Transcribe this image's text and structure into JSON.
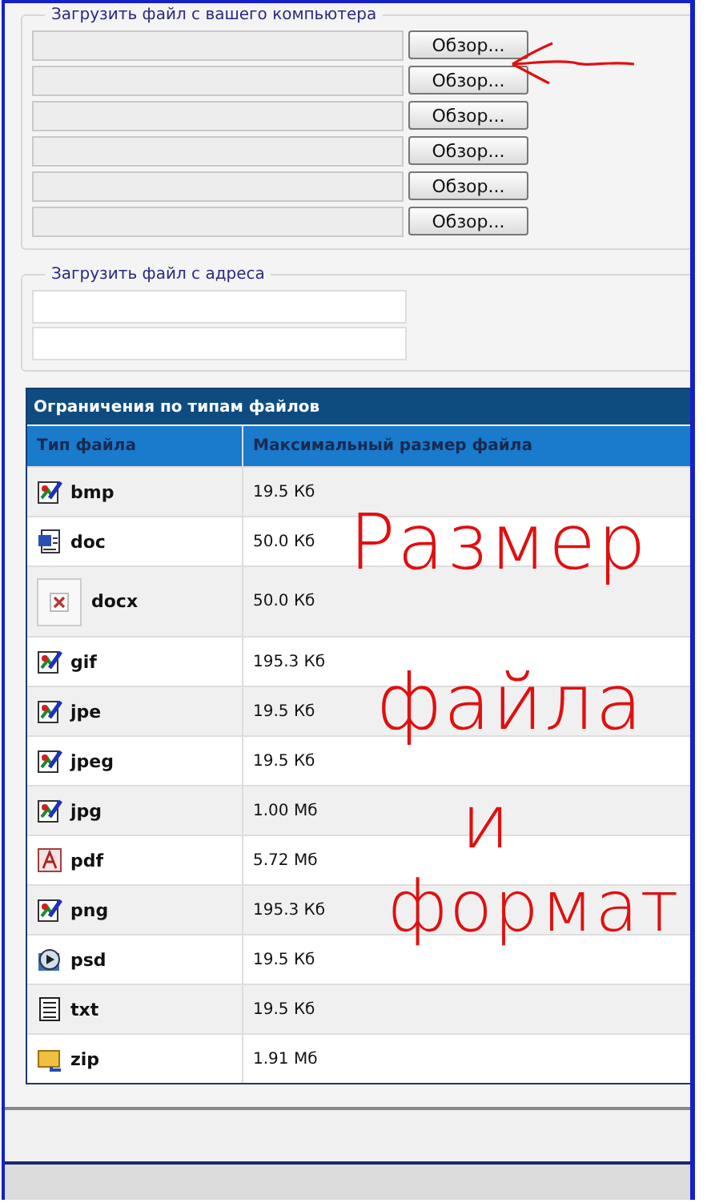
{
  "upload_from_computer": {
    "legend": "Загрузить файл с вашего компьютера",
    "rows": [
      {
        "button": "Обзор..."
      },
      {
        "button": "Обзор..."
      },
      {
        "button": "Обзор..."
      },
      {
        "button": "Обзор..."
      },
      {
        "button": "Обзор..."
      },
      {
        "button": "Обзор..."
      }
    ]
  },
  "upload_from_url": {
    "legend": "Загрузить файл с адреса"
  },
  "file_limits": {
    "title": "Ограничения по типам файлов",
    "columns": [
      "Тип файла",
      "Максимальный размер файла"
    ],
    "rows": [
      {
        "kind": "image",
        "type": "bmp",
        "size": "19.5 Кб"
      },
      {
        "kind": "word",
        "type": "doc",
        "size": "50.0 Кб"
      },
      {
        "kind": "broken",
        "type": "docx",
        "size": "50.0 Кб"
      },
      {
        "kind": "image",
        "type": "gif",
        "size": "195.3 Кб"
      },
      {
        "kind": "image",
        "type": "jpe",
        "size": "19.5 Кб"
      },
      {
        "kind": "image",
        "type": "jpeg",
        "size": "19.5 Кб"
      },
      {
        "kind": "image",
        "type": "jpg",
        "size": "1.00 Мб"
      },
      {
        "kind": "pdf",
        "type": "pdf",
        "size": "5.72 Мб"
      },
      {
        "kind": "image",
        "type": "png",
        "size": "195.3 Кб"
      },
      {
        "kind": "media",
        "type": "psd",
        "size": "19.5 Кб"
      },
      {
        "kind": "text",
        "type": "txt",
        "size": "19.5 Кб"
      },
      {
        "kind": "archive",
        "type": "zip",
        "size": "1.91 Мб"
      }
    ]
  },
  "annotation": {
    "lines": [
      "Размер",
      "файла",
      "и",
      "формат"
    ]
  }
}
